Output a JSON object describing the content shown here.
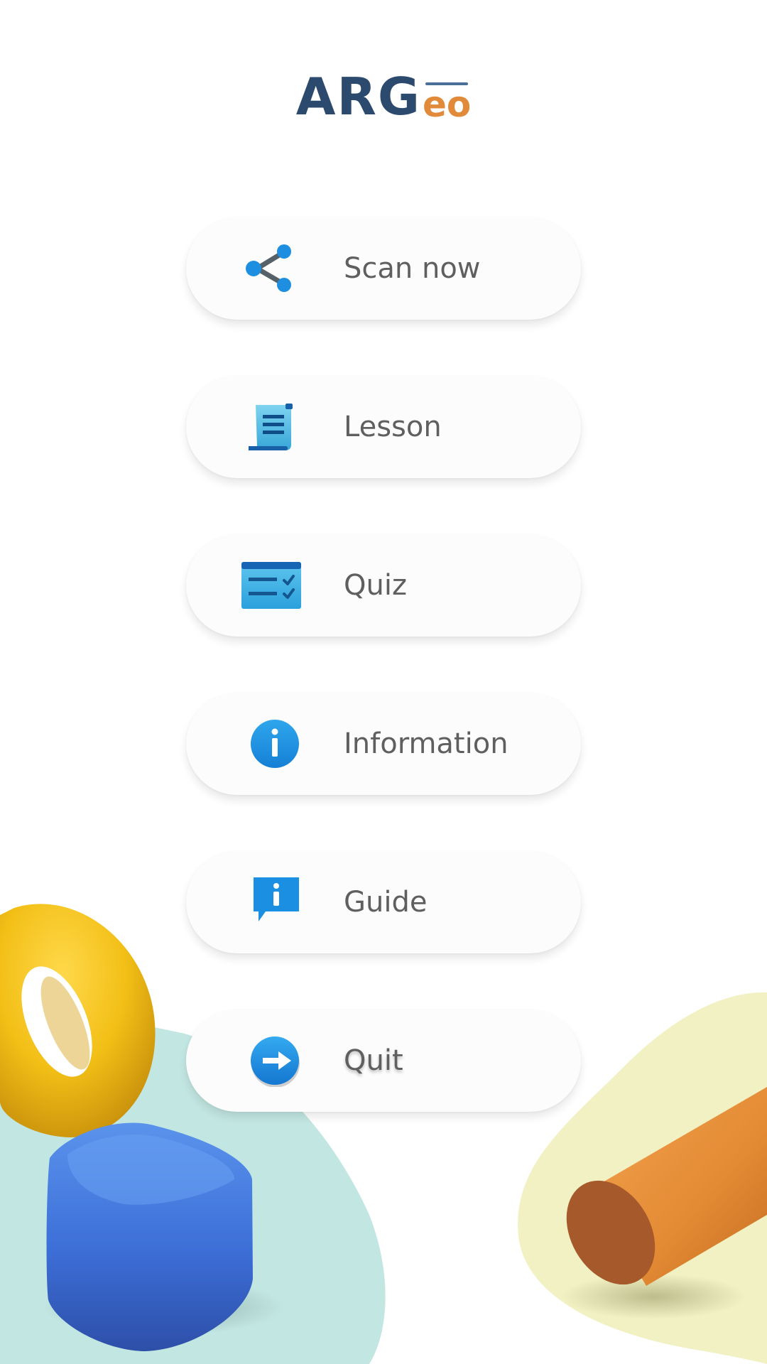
{
  "app": {
    "logo_main": "ARG",
    "logo_sub": "eo"
  },
  "colors": {
    "logo_main": "#2c4a6e",
    "logo_sub": "#e08a3a",
    "label_text": "#5f5f5f",
    "icon_blue": "#1e8fe0",
    "button_bg": "#fcfcfc"
  },
  "menu": {
    "items": [
      {
        "label": "Scan now",
        "icon": "share-nodes-icon"
      },
      {
        "label": "Lesson",
        "icon": "scroll-icon"
      },
      {
        "label": "Quiz",
        "icon": "checklist-icon"
      },
      {
        "label": "Information",
        "icon": "info-circle-icon"
      },
      {
        "label": "Guide",
        "icon": "info-speech-bubble-icon"
      },
      {
        "label": "Quit",
        "icon": "arrow-right-circle-icon"
      }
    ]
  }
}
